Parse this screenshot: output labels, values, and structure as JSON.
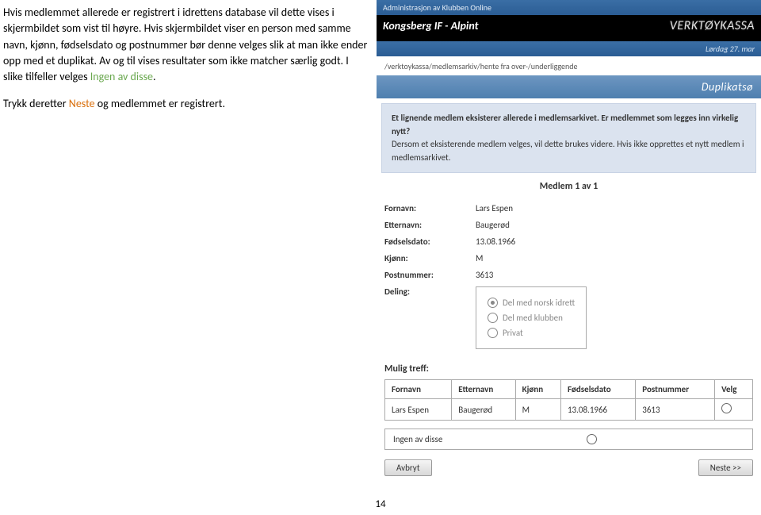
{
  "instructions": {
    "para1": "Hvis medlemmet allerede er registrert i idrettens database vil dette vises i skjermbildet som vist til høyre. Hvis skjermbildet viser en person med samme navn, kjønn, fødselsdato og postnummer bør denne velges slik at man ikke ender opp med et duplikat. Av og til vises resultater som ikke matcher særlig godt. I slike tilfeller velges ",
    "ingen_link": "Ingen av disse",
    "dot1": ".",
    "para2a": "Trykk deretter ",
    "neste_link": "Neste",
    "para2b": " og medlemmet er registrert."
  },
  "header": {
    "admin_label": "Administrasjon av Klubben Online",
    "club": "Kongsberg IF - Alpint",
    "tool": "VERKTØYKASSA",
    "date": "Lørdag 27. mar",
    "breadcrumb": "/verktoykassa/medlemsarkiv/hente fra over-/underliggende",
    "title": "Duplikatsø"
  },
  "desc": {
    "line1": "Et lignende medlem eksisterer allerede i medlemsarkivet. Er medlemmet som legges inn virkelig nytt?",
    "line2": "Dersom et eksisterende medlem velges, vil dette brukes videre. Hvis ikke opprettes et nytt medlem i medlemsarkivet."
  },
  "counter": "Medlem 1 av 1",
  "fields": {
    "fornavn_label": "Fornavn:",
    "fornavn_value": "Lars Espen",
    "etternavn_label": "Etternavn:",
    "etternavn_value": "Baugerød",
    "fdato_label": "Fødselsdato:",
    "fdato_value": "13.08.1966",
    "kjonn_label": "Kjønn:",
    "kjonn_value": "M",
    "postnr_label": "Postnummer:",
    "postnr_value": "3613",
    "deling_label": "Deling:"
  },
  "deling": {
    "opt1": "Del med norsk idrett",
    "opt2": "Del med klubben",
    "opt3": "Privat"
  },
  "mulig_label": "Mulig treff:",
  "table": {
    "h_fornavn": "Fornavn",
    "h_etternavn": "Etternavn",
    "h_kjonn": "Kjønn",
    "h_fdato": "Fødselsdato",
    "h_postnr": "Postnummer",
    "h_velg": "Velg",
    "r1_fornavn": "Lars Espen",
    "r1_etternavn": "Baugerød",
    "r1_kjonn": "M",
    "r1_fdato": "13.08.1966",
    "r1_postnr": "3613"
  },
  "ingen_label": "Ingen av disse",
  "buttons": {
    "avbryt": "Avbryt",
    "neste": "Neste >>"
  },
  "page_no": "14"
}
